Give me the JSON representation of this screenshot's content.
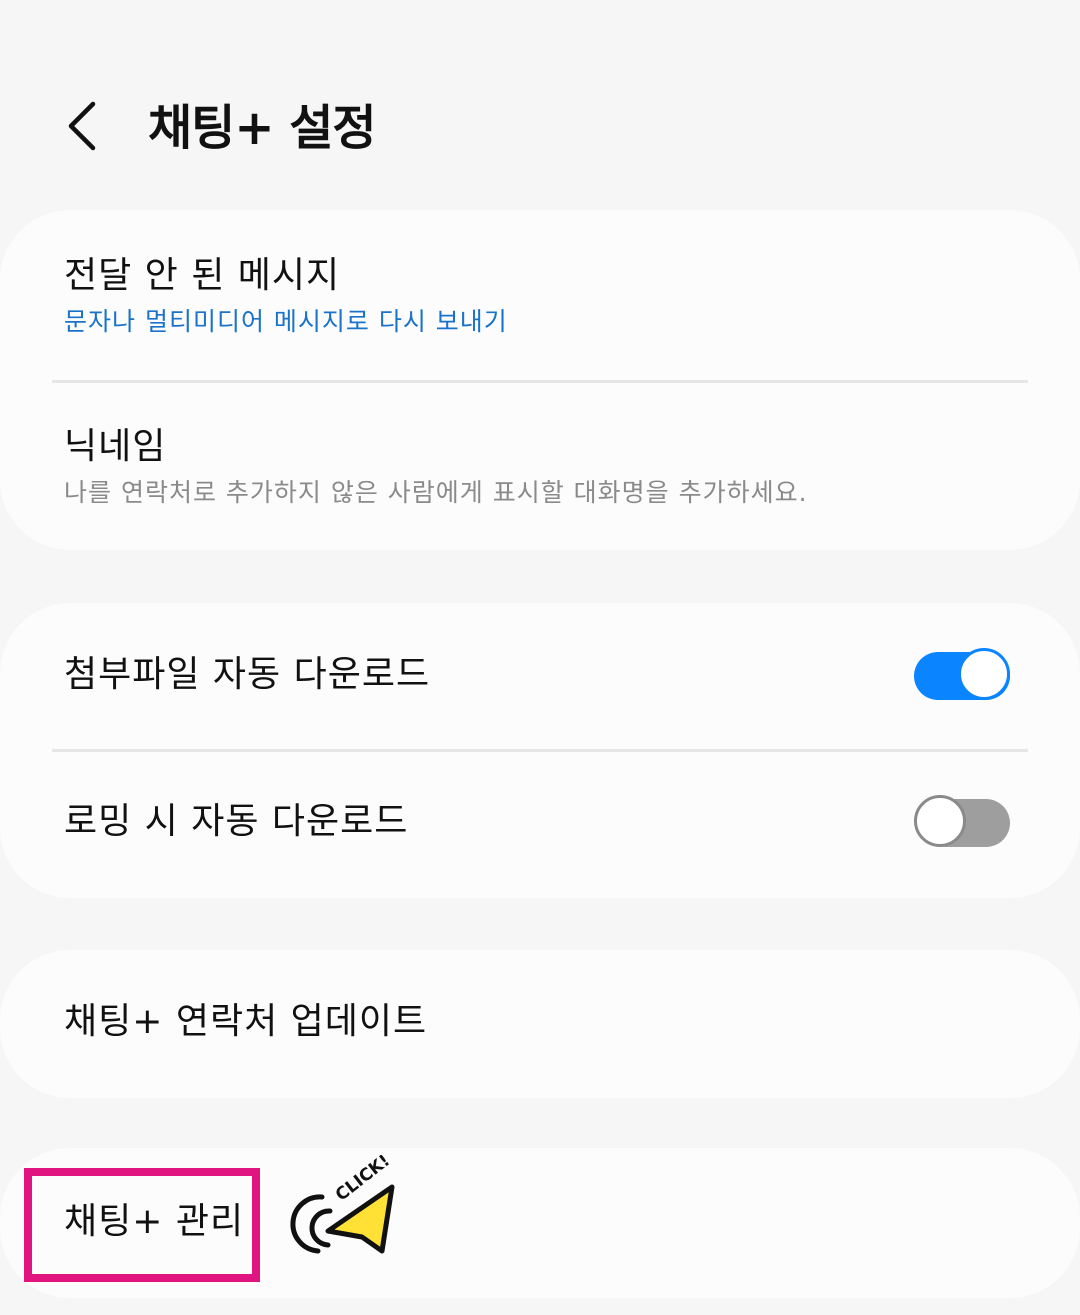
{
  "header": {
    "title": "채팅+ 설정",
    "back_icon": "chevron-left-icon"
  },
  "cards": {
    "undelivered": {
      "title": "전달 안 된 메시지",
      "subtitle": "문자나 멀티미디어 메시지로 다시 보내기"
    },
    "nickname": {
      "title": "닉네임",
      "subtitle": "나를 연락처로 추가하지 않은 사람에게 표시할 대화명을 추가하세요."
    },
    "auto_download": {
      "title": "첨부파일 자동 다운로드",
      "enabled": true
    },
    "roaming_download": {
      "title": "로밍 시 자동 다운로드",
      "enabled": false
    },
    "contacts_update": {
      "title": "채팅+ 연락처 업데이트"
    },
    "manage": {
      "title": "채팅+ 관리"
    }
  },
  "annotation": {
    "click_label": "CLICK!",
    "highlight_color": "#e0157f",
    "sticker_color": "#ffe035"
  },
  "colors": {
    "accent": "#0a84ff",
    "link": "#1a73c9",
    "toggle_off": "#9e9e9e",
    "background": "#f6f6f6",
    "card": "#fcfcfc"
  }
}
